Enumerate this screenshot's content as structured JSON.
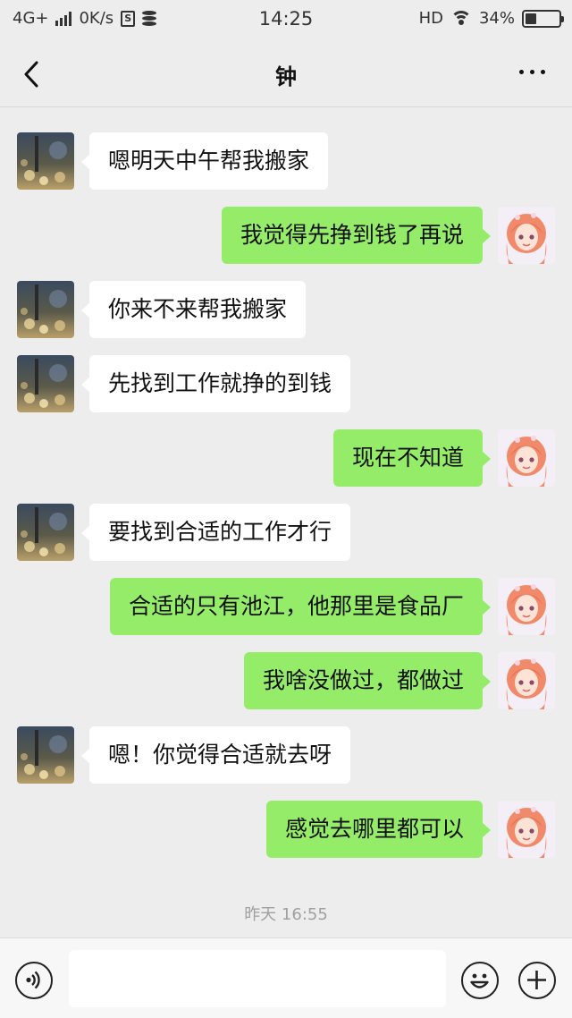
{
  "status_bar": {
    "network": "4G+",
    "speed": "0K/s",
    "time": "14:25",
    "hd": "HD",
    "battery_text": "34%",
    "battery_level": 0.34,
    "icons": [
      "signal-icon",
      "storage-s-icon",
      "database-icon",
      "wifi-icon",
      "battery-icon"
    ]
  },
  "nav": {
    "title": "钟",
    "back_icon": "chevron-left-icon",
    "more_icon": "more-dots-icon"
  },
  "messages": [
    {
      "from": "other",
      "text": "嗯明天中午帮我搬家"
    },
    {
      "from": "me",
      "text": "我觉得先挣到钱了再说"
    },
    {
      "from": "other",
      "text": "你来不来帮我搬家"
    },
    {
      "from": "other",
      "text": "先找到工作就挣的到钱"
    },
    {
      "from": "me",
      "text": "现在不知道"
    },
    {
      "from": "other",
      "text": "要找到合适的工作才行"
    },
    {
      "from": "me",
      "text": "合适的只有池江，他那里是食品厂"
    },
    {
      "from": "me",
      "text": "我啥没做过，都做过"
    },
    {
      "from": "other",
      "text": "嗯！你觉得合适就去呀"
    },
    {
      "from": "me",
      "text": "感觉去哪里都可以"
    }
  ],
  "timestamp": "昨天 16:55",
  "input_bar": {
    "value": "",
    "voice_icon": "voice-icon",
    "emoji_icon": "emoji-icon",
    "plus_icon": "plus-icon"
  },
  "colors": {
    "background": "#ededed",
    "my_bubble": "#95ec69",
    "other_bubble": "#ffffff"
  }
}
